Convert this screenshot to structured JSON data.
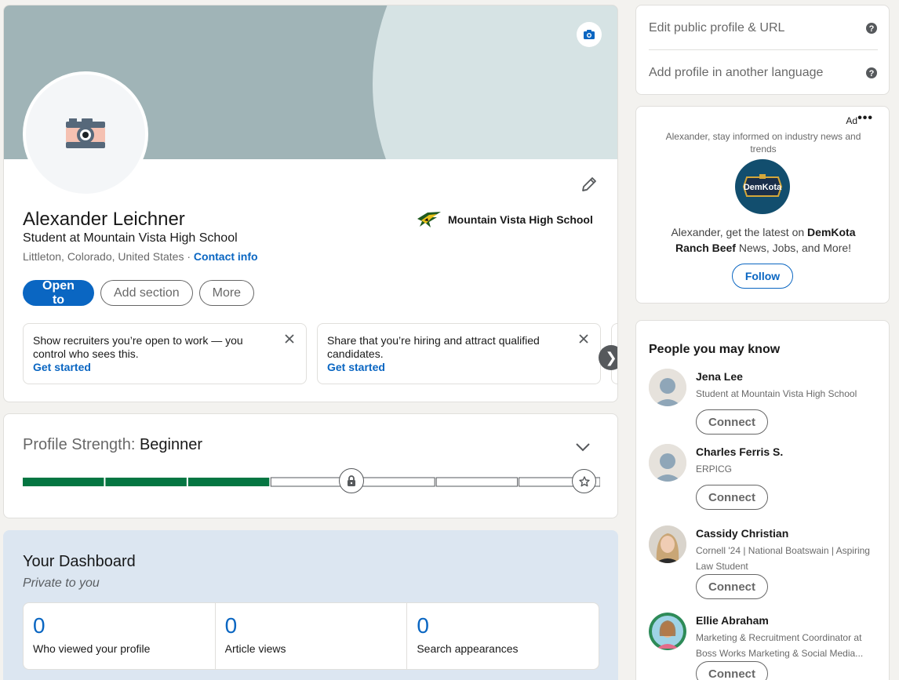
{
  "profile": {
    "name": "Alexander Leichner",
    "headline": "Student at Mountain Vista High School",
    "location": "Littleton, Colorado, United States",
    "separator": " · ",
    "contact_info_label": "Contact info",
    "school": "Mountain Vista High School",
    "buttons": {
      "open_to": "Open to",
      "add_section": "Add section",
      "more": "More"
    },
    "prompts": [
      {
        "text_lead": "Show recruiters you’re open to work",
        "text_tail": " — you control who sees this.",
        "link": "Get started"
      },
      {
        "text_lead": "Share that you’re hiring",
        "text_tail": " and attract qualified candidates.",
        "link": "Get started"
      }
    ],
    "carousel_next": "❯"
  },
  "strength": {
    "label": "Profile Strength: ",
    "level": "Beginner",
    "filled_segments": 3,
    "total_segments": 7,
    "color_filled": "#057642"
  },
  "dashboard": {
    "title": "Your Dashboard",
    "subtitle": "Private to you",
    "stats": [
      {
        "value": "0",
        "label": "Who viewed your profile"
      },
      {
        "value": "0",
        "label": "Article views"
      },
      {
        "value": "0",
        "label": "Search appearances"
      }
    ]
  },
  "rail_links": {
    "edit_public": "Edit public profile & URL",
    "add_language": "Add profile in another language"
  },
  "ad": {
    "label": "Ad",
    "menu": "•••",
    "tagline": "Alexander, stay informed on industry news and trends",
    "logo_text": "DemKota",
    "body_lead": "Alexander, get the latest on ",
    "company": "DemKota Ranch Beef",
    "body_tail": " News, Jobs, and More!",
    "follow": "Follow"
  },
  "pymk": {
    "title": "People you may know",
    "connect_label": "Connect",
    "people": [
      {
        "name": "Jena Lee",
        "desc": "Student at Mountain Vista High School"
      },
      {
        "name": "Charles Ferris S.",
        "desc": "ERPICG"
      },
      {
        "name": "Cassidy Christian",
        "desc": "Cornell '24 | National Boatswain | Aspiring Law Student"
      },
      {
        "name": "Ellie Abraham",
        "desc": "Marketing & Recruitment Coordinator at Boss Works Marketing & Social Media..."
      }
    ]
  },
  "colors": {
    "brand_blue": "#0a66c2",
    "page_bg": "#f3f2ef"
  }
}
